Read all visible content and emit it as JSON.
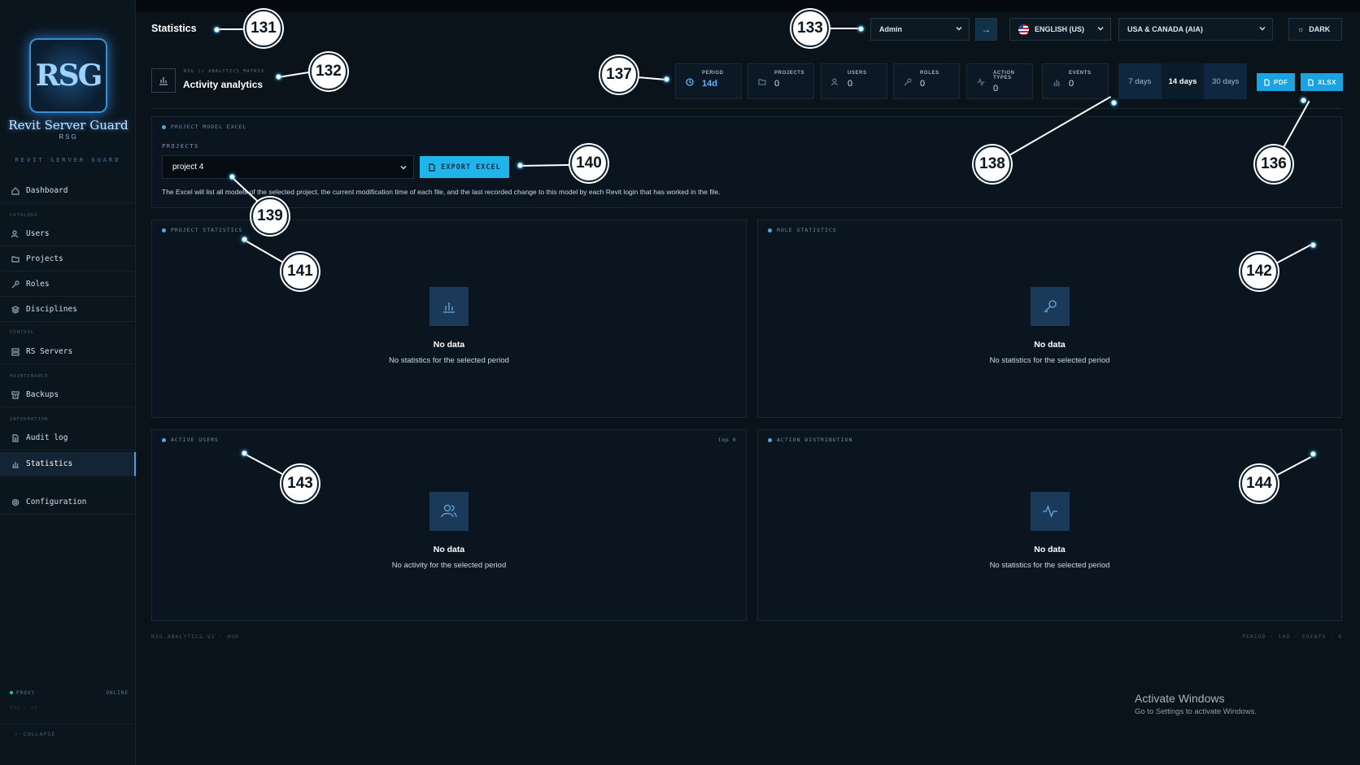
{
  "sidebar": {
    "logo_text": "RSG",
    "logo_title": "Revit Server Guard",
    "logo_sub": "RSG",
    "brand": "REVIT SERVER GUARD",
    "sections": {
      "catalogs": "CATALOGS",
      "control": "CONTROL",
      "maintenance": "MAINTENANCE",
      "information": "INFORMATION"
    },
    "items": [
      {
        "label": "Dashboard",
        "icon": "home-icon"
      },
      {
        "label": "Users",
        "icon": "users-icon"
      },
      {
        "label": "Projects",
        "icon": "folder-icon"
      },
      {
        "label": "Roles",
        "icon": "key-icon"
      },
      {
        "label": "Disciplines",
        "icon": "layers-icon"
      },
      {
        "label": "RS Servers",
        "icon": "server-icon"
      },
      {
        "label": "Backups",
        "icon": "archive-icon"
      },
      {
        "label": "Audit log",
        "icon": "document-icon"
      },
      {
        "label": "Statistics",
        "icon": "bar-chart-icon"
      },
      {
        "label": "Configuration",
        "icon": "gear-icon"
      }
    ],
    "active": "Statistics",
    "proxy_label": "PROXY",
    "proxy_status": "ONLINE",
    "version": "RSG · V1",
    "collapse_label": "COLLAPSE"
  },
  "header": {
    "title": "Statistics",
    "user_select": "Admin",
    "language": "ENGLISH (US)",
    "region": "USA & CANADA (AIA)",
    "theme": "DARK",
    "breadcrumb": "RSG // ANALYTICS MATRIX",
    "section_title": "Activity analytics",
    "stats": [
      {
        "label": "PERIOD",
        "value": "14d",
        "icon": "clock-icon"
      },
      {
        "label": "PROJECTS",
        "value": "0",
        "icon": "folder-icon"
      },
      {
        "label": "USERS",
        "value": "0",
        "icon": "users-icon"
      },
      {
        "label": "ROLES",
        "value": "0",
        "icon": "key-icon"
      },
      {
        "label": "ACTION TYPES",
        "value": "0",
        "icon": "activity-icon"
      },
      {
        "label": "EVENTS",
        "value": "0",
        "icon": "bar-chart-icon"
      }
    ],
    "periods": [
      "7 days",
      "14 days",
      "30 days"
    ],
    "selected_period": "14 days",
    "pdf_label": "PDF",
    "xlsx_label": "XLSX"
  },
  "excel_panel": {
    "title": "PROJECT MODEL EXCEL",
    "projects_label": "PROJECTS",
    "selected_project": "project 4",
    "export_label": "EXPORT EXCEL",
    "description": "The Excel will list all models of the selected project, the current modification time of each file, and the last recorded change to this model by each Revit login that has worked in the file."
  },
  "panels": {
    "project_stats": {
      "title": "PROJECT STATISTICS",
      "empty_title": "No data",
      "empty_text": "No statistics for the selected period"
    },
    "role_stats": {
      "title": "ROLE STATISTICS",
      "empty_title": "No data",
      "empty_text": "No statistics for the selected period"
    },
    "active_users": {
      "title": "ACTIVE USERS",
      "badge": "top 0",
      "empty_title": "No data",
      "empty_text": "No activity for the selected period"
    },
    "action_distribution": {
      "title": "ACTION DISTRIBUTION",
      "empty_title": "No data",
      "empty_text": "No statistics for the selected period"
    }
  },
  "footer": {
    "left": "RSG.ANALYTICS.V2 · HUD",
    "right": "PERIOD · 14D · EVENTS · 0"
  },
  "activate_windows": {
    "title": "Activate Windows",
    "text": "Go to Settings to activate Windows."
  },
  "callouts": [
    "131",
    "132",
    "133",
    "136",
    "137",
    "138",
    "139",
    "140",
    "141",
    "142",
    "143",
    "144"
  ],
  "colors": {
    "accent": "#1fb4ea",
    "background": "#0a121a",
    "panel": "#0b151f",
    "online": "#2fcf78"
  }
}
